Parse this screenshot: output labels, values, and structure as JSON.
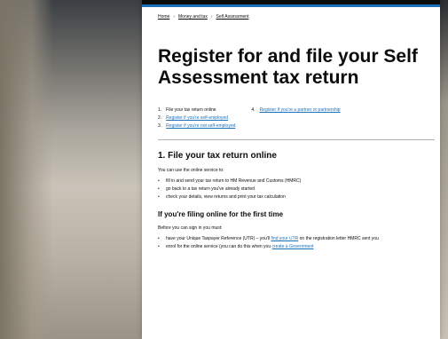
{
  "breadcrumb": [
    "Home",
    "Money and tax",
    "Self Assessment"
  ],
  "title": "Register for and file your Self Assessment tax return",
  "contents": [
    {
      "num": "1.",
      "label": "File your tax return online",
      "link": false
    },
    {
      "num": "2.",
      "label": "Register if you're self-employed",
      "link": true
    },
    {
      "num": "3.",
      "label": "Register if you're not self-employed",
      "link": true
    },
    {
      "num": "4.",
      "label": "Register if you're a partner or partnership",
      "link": true
    }
  ],
  "section1": {
    "heading": "1. File your tax return online",
    "intro": "You can use the online service to:",
    "bullets": [
      "fill in and send your tax return to HM Revenue and Customs (HMRC)",
      "go back to a tax return you've already started",
      "check your details, view returns and print your tax calculation"
    ]
  },
  "first_time": {
    "heading": "If you're filing online for the first time",
    "intro": "Before you can sign in you must:",
    "bullet1_prefix": "have your Unique Taxpayer Reference (UTR) – you'll ",
    "bullet1_link": "find your UTR",
    "bullet1_suffix": " on the registration letter HMRC sent you",
    "bullet2_prefix": "enrol for the online service (you can do this when you ",
    "bullet2_link": "create a Government"
  },
  "colors": {
    "link": "#1d70b8",
    "header": "#0b0c0c",
    "accent": "#1d70b8"
  }
}
